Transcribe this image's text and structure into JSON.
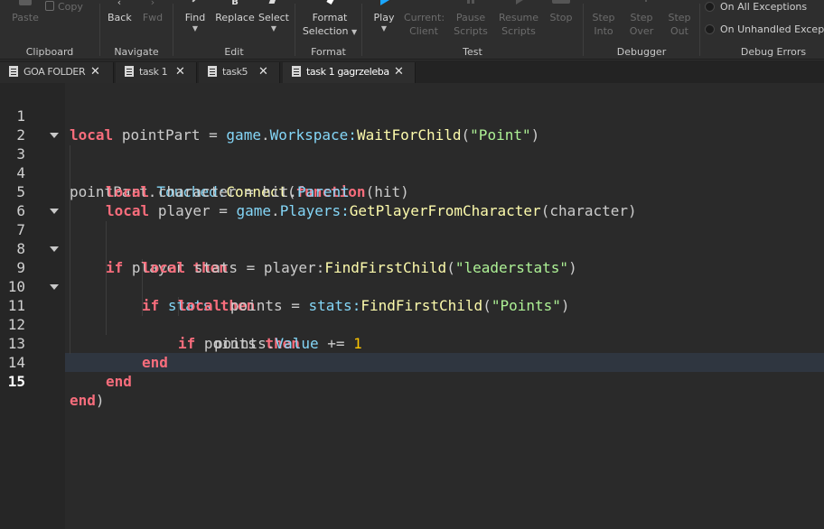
{
  "ribbon": {
    "clipboard": {
      "title": "Clipboard",
      "paste": "Paste",
      "copy": "Copy"
    },
    "navigate": {
      "title": "Navigate",
      "back": "Back",
      "fwd": "Fwd"
    },
    "edit": {
      "title": "Edit",
      "find": "Find",
      "replace": "Replace",
      "select": "Select"
    },
    "format": {
      "title": "Format",
      "format_line1": "Format",
      "format_line2": "Selection"
    },
    "test": {
      "title": "Test",
      "play": "Play",
      "current_1": "Current:",
      "current_2": "Client",
      "pause_1": "Pause",
      "pause_2": "Scripts",
      "resume_1": "Resume",
      "resume_2": "Scripts",
      "stop": "Stop"
    },
    "debugger": {
      "title": "Debugger",
      "into_1": "Step",
      "into_2": "Into",
      "over_1": "Step",
      "over_2": "Over",
      "out_1": "Step",
      "out_2": "Out"
    },
    "debug_errors": {
      "title": "Debug Errors",
      "all": "On All Exceptions",
      "unhandled": "On Unhandled Exceptions"
    }
  },
  "tabs": [
    {
      "label": "GOA FOLDER",
      "icon": "folder-script-icon"
    },
    {
      "label": "task 1",
      "icon": "script-icon"
    },
    {
      "label": "task5",
      "icon": "script-icon"
    },
    {
      "label": "task 1 gagrzeleba",
      "icon": "script-icon",
      "active": true
    }
  ],
  "close_glyph": "✕",
  "editor": {
    "current_line": 15,
    "lines": [
      {
        "n": "1"
      },
      {
        "n": "2"
      },
      {
        "n": "3"
      },
      {
        "n": "4"
      },
      {
        "n": "5"
      },
      {
        "n": "6"
      },
      {
        "n": "7"
      },
      {
        "n": "8"
      },
      {
        "n": "9"
      },
      {
        "n": "10"
      },
      {
        "n": "11"
      },
      {
        "n": "12"
      },
      {
        "n": "13"
      },
      {
        "n": "14"
      },
      {
        "n": "15"
      }
    ],
    "tokens": {
      "t_local": "local",
      "t_pointPart": "pointPart",
      "t_eq": " = ",
      "t_game": "game",
      "t_dot": ".",
      "t_Workspace": "Workspace",
      "t_colon": ":",
      "t_WaitForChild": "WaitForChild",
      "t_lp": "(",
      "t_rp": ")",
      "t_Point": "\"Point\"",
      "t_Touched": "Touched",
      "t_Connect": "Connect",
      "t_function": "function",
      "t_hit": "hit",
      "t_character": "character",
      "t_Parent": "Parent",
      "t_player": "player",
      "t_Players": "Players",
      "t_GetPlayerFromCharacter": "GetPlayerFromCharacter",
      "t_if": "if",
      "t_then": "then",
      "t_stats": "stats",
      "t_FindFirstChild": "FindFirstChild",
      "t_leaderstats": "\"leaderstats\"",
      "t_points": "points",
      "t_Points": "\"Points\"",
      "t_Value": "Value",
      "t_pluseq": " += ",
      "t_one": "1",
      "t_end": "end"
    }
  }
}
